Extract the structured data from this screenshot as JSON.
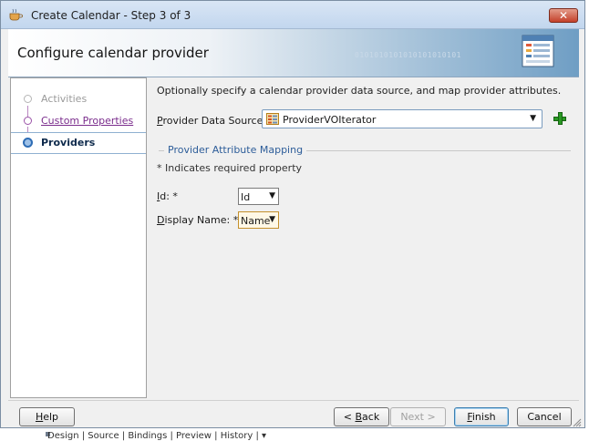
{
  "window": {
    "title": "Create Calendar - Step 3 of 3",
    "close_symbol": "✕"
  },
  "header": {
    "title": "Configure calendar provider",
    "binary_decoration": "0101010101010101010101"
  },
  "nav": {
    "items": [
      {
        "label": "Activities",
        "state": "disabled"
      },
      {
        "label": "Custom Properties",
        "state": "link"
      },
      {
        "label": "Providers",
        "state": "active"
      }
    ]
  },
  "main": {
    "intro": "Optionally specify a calendar provider data source, and map provider attributes.",
    "provider_data_source": {
      "label_prefix": "",
      "label_underlined": "P",
      "label_rest": "rovider Data Source:",
      "value": "ProviderVOIterator",
      "icon": "iterator-icon"
    },
    "add_icon": "add-plus-icon",
    "mapping": {
      "title": "Provider Attribute Mapping",
      "required_note": "* Indicates required property",
      "fields": [
        {
          "label_underlined": "I",
          "label_rest": "d: *",
          "value": "Id"
        },
        {
          "label_underlined": "D",
          "label_rest": "isplay Name: *",
          "value": "Name"
        }
      ]
    }
  },
  "buttons": {
    "help": {
      "u": "H",
      "rest": "elp"
    },
    "back": {
      "pre": "< ",
      "u": "B",
      "rest": "ack"
    },
    "next": {
      "label": "Next >"
    },
    "finish": {
      "u": "F",
      "rest": "inish"
    },
    "cancel": {
      "label": "Cancel"
    }
  },
  "background": {
    "tabs": "Design | Source | Bindings | Preview | History | ▾"
  },
  "colors": {
    "accent": "#2f6db5",
    "link": "#7a2c8c",
    "section_title": "#2d5d99",
    "add_green": "#2a9a24"
  }
}
